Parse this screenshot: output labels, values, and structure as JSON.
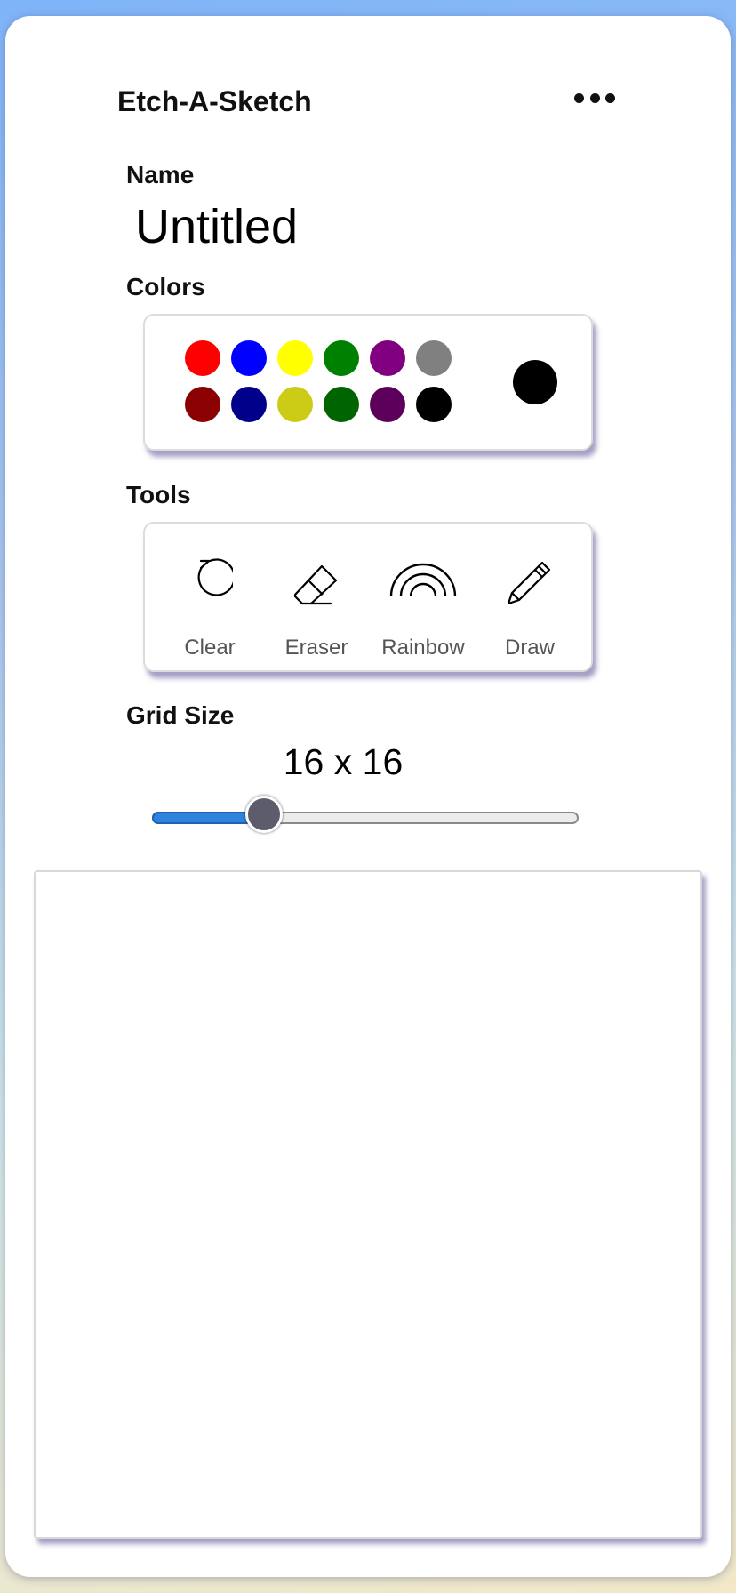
{
  "header": {
    "title": "Etch-A-Sketch",
    "menu_icon": "more-dots-icon"
  },
  "name": {
    "label": "Name",
    "value": "Untitled"
  },
  "colors": {
    "label": "Colors",
    "palette": [
      "#ff0000",
      "#0000ff",
      "#ffff00",
      "#008000",
      "#800080",
      "#808080",
      "#8b0000",
      "#00008b",
      "#cccc16",
      "#006400",
      "#5c005c",
      "#000000"
    ],
    "current": "#000000"
  },
  "tools": {
    "label": "Tools",
    "items": [
      {
        "label": "Clear",
        "icon": "clear-icon"
      },
      {
        "label": "Eraser",
        "icon": "eraser-icon"
      },
      {
        "label": "Rainbow",
        "icon": "rainbow-icon"
      },
      {
        "label": "Draw",
        "icon": "pencil-icon"
      }
    ]
  },
  "grid": {
    "label": "Grid Size",
    "value_text": "16 x 16",
    "slider_fraction": 0.26
  }
}
